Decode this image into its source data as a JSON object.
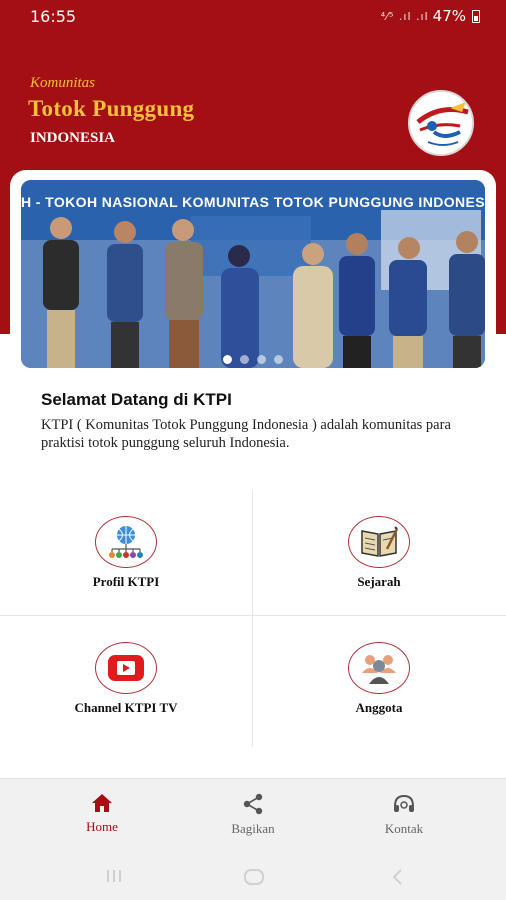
{
  "status_bar": {
    "time": "16:55",
    "battery": "47%"
  },
  "header": {
    "subtitle": "Komunitas",
    "title": "Totok Punggung",
    "country": "INDONESIA",
    "accent_color": "#a30f13",
    "title_color": "#f3c13b"
  },
  "banner": {
    "caption": "H - TOKOH NASIONAL  KOMUNITAS TOTOK PUNGGUNG INDONESIA",
    "slide_count": 4,
    "active_slide": 1
  },
  "welcome": {
    "title": "Selamat Datang di KTPI",
    "text": "KTPI ( Komunitas Totok Punggung Indonesia ) adalah komunitas para praktisi totok punggung seluruh Indonesia."
  },
  "menu": [
    {
      "label": "Profil KTPI",
      "icon": "network-icon"
    },
    {
      "label": "Sejarah",
      "icon": "book-icon"
    },
    {
      "label": "Channel KTPI TV",
      "icon": "youtube-icon"
    },
    {
      "label": "Anggota",
      "icon": "members-icon"
    }
  ],
  "bottom_nav": [
    {
      "label": "Home",
      "icon": "home-icon",
      "active": true
    },
    {
      "label": "Bagikan",
      "icon": "share-icon",
      "active": false
    },
    {
      "label": "Kontak",
      "icon": "headset-icon",
      "active": false
    }
  ]
}
